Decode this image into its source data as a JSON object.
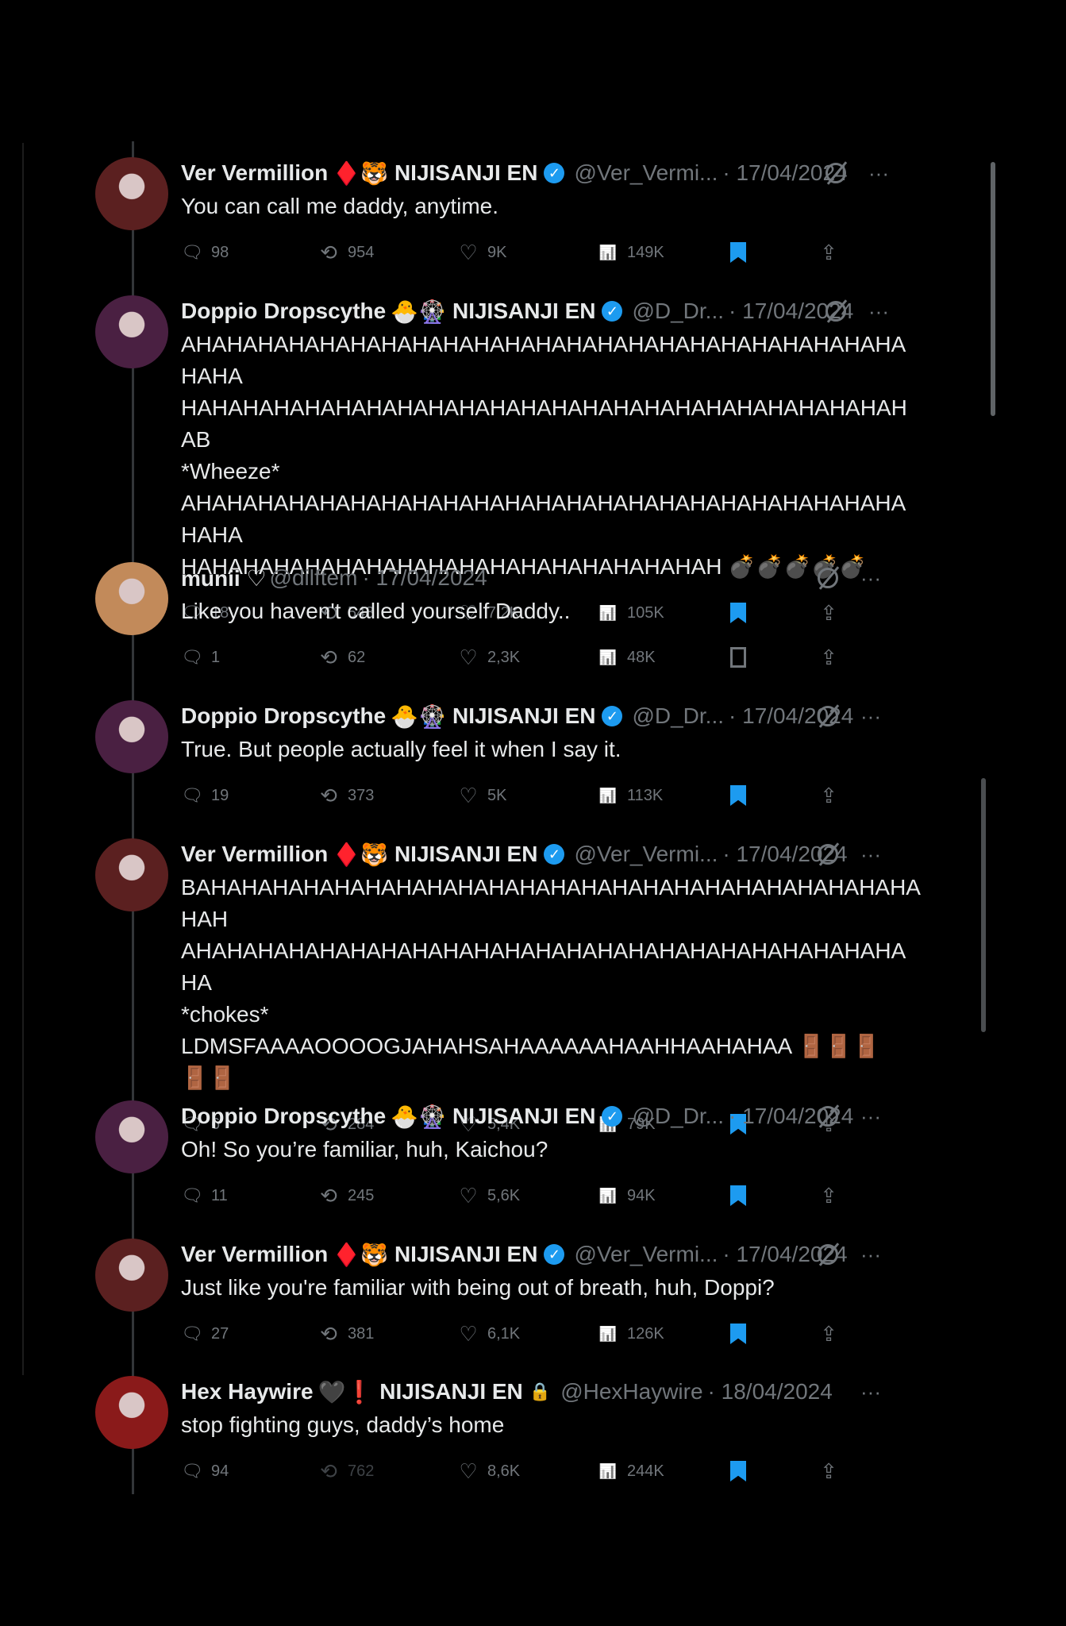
{
  "tweets": [
    {
      "name": "Ver Vermillion",
      "emojis": "♦️🐯",
      "tag": "NIJISANJI EN",
      "verified": true,
      "handle": "@Ver_Vermi...",
      "date": "· 17/04/2024",
      "text": "You can call me daddy, anytime.",
      "reply": "98",
      "retweet": "954",
      "like": "9K",
      "views": "149K",
      "bookmarked": true,
      "avatar_color": "#5b2020"
    },
    {
      "name": "Doppio Dropscythe",
      "emojis": "🐣🎡",
      "tag": "NIJISANJI EN",
      "verified": true,
      "handle": "@D_Dr...",
      "date": "· 17/04/2024",
      "text": "AHAHAHAHAHAHAHAHAHAHAHAHAHAHAHAHAHAHAHAHAHAHAHAHAHA\nHAHAHAHAHAHAHAHAHAHAHAHAHAHAHAHAHAHAHAHAHAHAHAHAB\n*Wheeze*\nAHAHAHAHAHAHAHAHAHAHAHAHAHAHAHAHAHAHAHAHAHAHAHAHAHA\nHAHAHAHAHAHAHAHAHAHAHAHAHAHAHAHAHAH 💣💣💣💣💣",
      "reply": "18",
      "retweet": "548",
      "like": "7,2K",
      "views": "105K",
      "bookmarked": true,
      "avatar_color": "#4a2042"
    },
    {
      "name": "munii ♡",
      "emojis": "",
      "tag": "",
      "verified": false,
      "handle": "@dilftem",
      "date": "· 17/04/2024",
      "text": "Like you haven't called yourself Daddy..",
      "reply": "1",
      "retweet": "62",
      "like": "2,3K",
      "views": "48K",
      "bookmarked": false,
      "avatar_color": "#c28a5a"
    },
    {
      "name": "Doppio Dropscythe",
      "emojis": "🐣🎡",
      "tag": "NIJISANJI EN",
      "verified": true,
      "handle": "@D_Dr...",
      "date": "· 17/04/2024",
      "text": "True. But people actually feel it when I say it.",
      "reply": "19",
      "retweet": "373",
      "like": "5K",
      "views": "113K",
      "bookmarked": true,
      "avatar_color": "#4a2042"
    },
    {
      "name": "Ver Vermillion",
      "emojis": "♦️🐯",
      "tag": "NIJISANJI EN",
      "verified": true,
      "handle": "@Ver_Vermi...",
      "date": "· 17/04/2024",
      "text": "BAHAHAHAHAHAHAHAHAHAHAHAHAHAHAHAHAHAHAHAHAHAHAHAHAH\nAHAHAHAHAHAHAHAHAHAHAHAHAHAHAHAHAHAHAHAHAHAHAHAHA\n*chokes*\nLDMSFAAAAOOOOGJAHAHSAHAAAAAAHAAHHAAHAHAA 🚪🚪🚪\n🚪🚪",
      "reply": "6",
      "retweet": "284",
      "like": "5,4K",
      "views": "79K",
      "bookmarked": true,
      "avatar_color": "#5b2020"
    },
    {
      "name": "Doppio Dropscythe",
      "emojis": "🐣🎡",
      "tag": "NIJISANJI EN",
      "verified": true,
      "handle": "@D_Dr...",
      "date": "· 17/04/2024",
      "text": "Oh! So you’re familiar, huh, Kaichou?",
      "reply": "11",
      "retweet": "245",
      "like": "5,6K",
      "views": "94K",
      "bookmarked": true,
      "avatar_color": "#4a2042"
    },
    {
      "name": "Ver Vermillion",
      "emojis": "♦️🐯",
      "tag": "NIJISANJI EN",
      "verified": true,
      "handle": "@Ver_Vermi...",
      "date": "· 17/04/2024",
      "text": "Just like you're familiar with being out of breath, huh, Doppi?",
      "reply": "27",
      "retweet": "381",
      "like": "6,1K",
      "views": "126K",
      "bookmarked": true,
      "avatar_color": "#5b2020"
    },
    {
      "name": "Hex Haywire",
      "emojis": "🖤❗",
      "tag": "NIJISANJI EN",
      "verified": false,
      "locked": true,
      "handle": "@HexHaywire",
      "date": "· 18/04/2024",
      "text": "stop fighting guys, daddy’s home",
      "reply": "94",
      "retweet": "762",
      "like": "8,6K",
      "views": "244K",
      "bookmarked": true,
      "avatar_color": "#8a1a1a"
    }
  ],
  "icons": {
    "reply": "speech-bubble-icon",
    "retweet": "retweet-icon",
    "like": "heart-icon",
    "views": "bar-chart-icon",
    "bookmark": "bookmark-icon",
    "share": "share-icon",
    "grok": "grok-icon",
    "more": "more-icon"
  },
  "colors": {
    "background": "#000000",
    "text": "#e7e9ea",
    "muted": "#71767b",
    "accent": "#1d9bf0"
  }
}
